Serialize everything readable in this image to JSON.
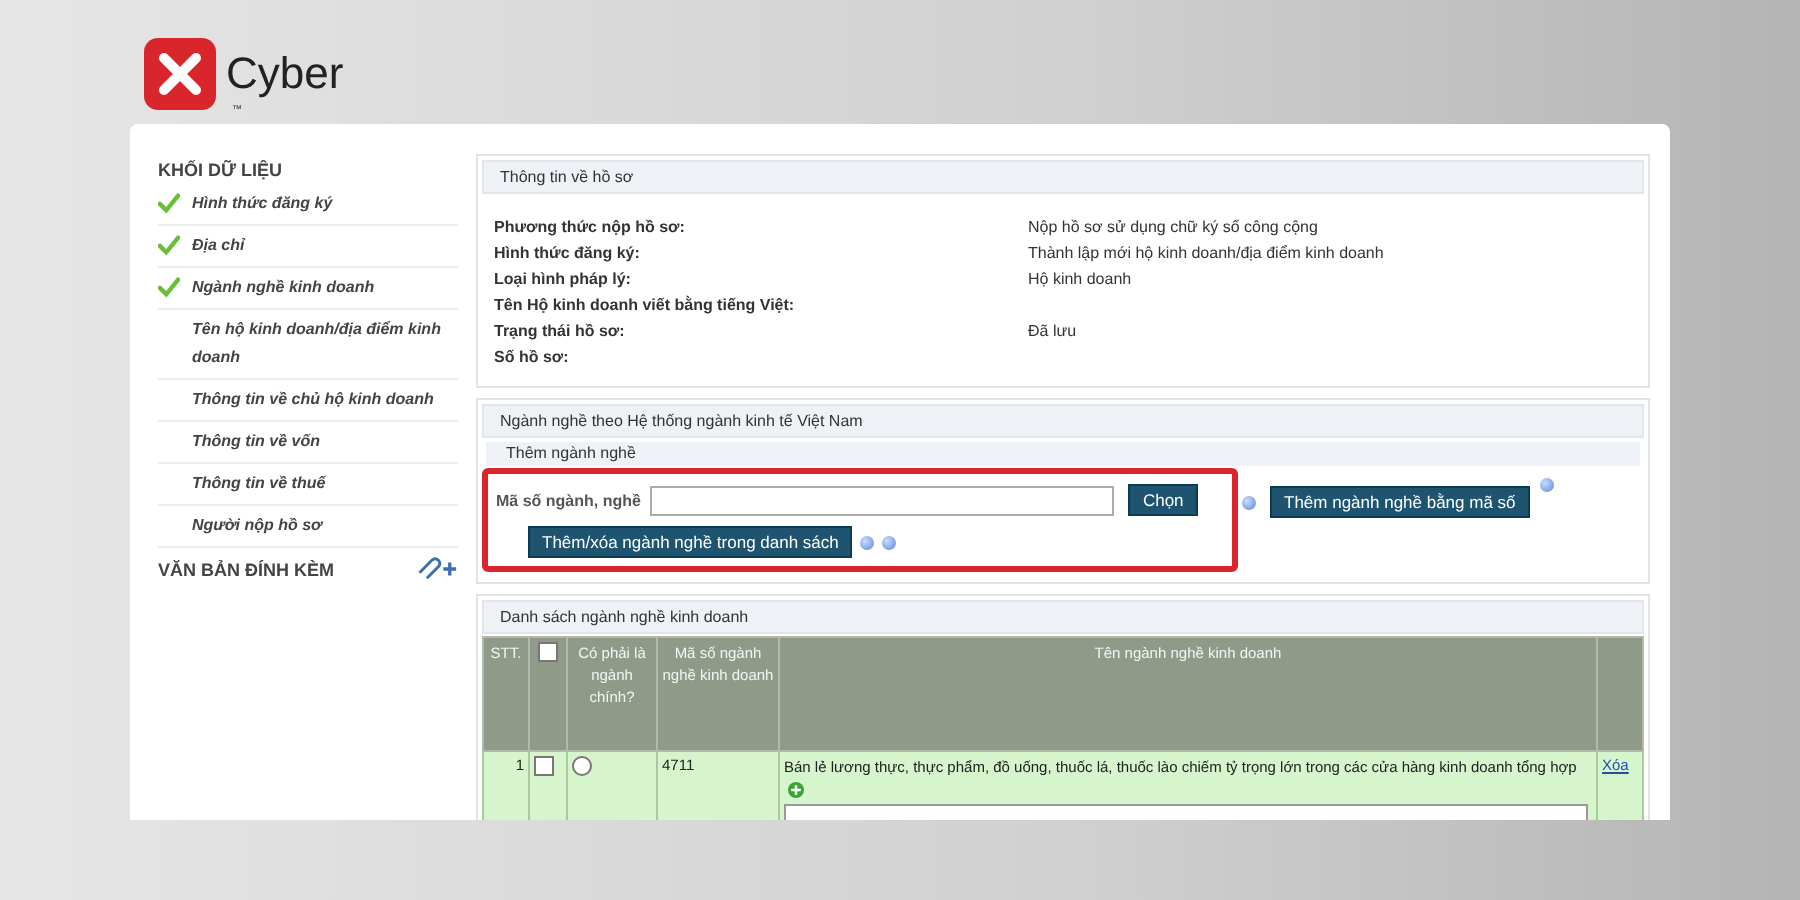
{
  "logo": {
    "name": "Cyber",
    "tm": "™"
  },
  "sidebar": {
    "heading": "KHỐI DỮ LIỆU",
    "items": [
      {
        "label": "Hình thức đăng ký",
        "done": true
      },
      {
        "label": "Địa chỉ",
        "done": true
      },
      {
        "label": "Ngành nghề kinh doanh",
        "done": true
      },
      {
        "label": "Tên hộ kinh doanh/địa điểm kinh doanh",
        "done": false
      },
      {
        "label": "Thông tin về chủ hộ kinh doanh",
        "done": false
      },
      {
        "label": "Thông tin về vốn",
        "done": false
      },
      {
        "label": "Thông tin về thuế",
        "done": false
      },
      {
        "label": "Người nộp hồ sơ",
        "done": false
      }
    ],
    "attachments": "VĂN BẢN ĐÍNH KÈM"
  },
  "record_info": {
    "title": "Thông tin về hồ sơ",
    "fields": [
      {
        "label": "Phương thức nộp hồ sơ:",
        "value": "Nộp hồ sơ sử dụng chữ ký số công cộng"
      },
      {
        "label": "Hình thức đăng ký:",
        "value": "Thành lập mới hộ kinh doanh/địa điểm kinh doanh"
      },
      {
        "label": "Loại hình pháp lý:",
        "value": "Hộ kinh doanh"
      },
      {
        "label": "Tên Hộ kinh doanh viết bằng tiếng Việt:"
      },
      {
        "label": "Trạng thái hồ sơ:",
        "value": "Đã lưu"
      },
      {
        "label": "Số hồ sơ:"
      }
    ]
  },
  "industry": {
    "title": "Ngành nghề theo Hệ thống ngành kinh tế Việt Nam",
    "subtitle": "Thêm ngành nghề",
    "code_label": "Mã số ngành, nghề",
    "choose_button": "Chọn",
    "add_by_code_button": "Thêm ngành nghề bằng mã số",
    "edit_list_button": "Thêm/xóa ngành nghề trong danh sách"
  },
  "list": {
    "title": "Danh sách ngành nghề kinh doanh",
    "select_all": false,
    "columns": [
      "STT.",
      "Có phải là ngành chính?",
      "Mã số ngành nghề kinh doanh",
      "Tên ngành nghề kinh doanh"
    ],
    "rows": [
      {
        "index": "1",
        "checked": false,
        "main": false,
        "code": "4711",
        "name": "Bán lẻ lương thực, thực phẩm, đồ uống, thuốc lá, thuốc lào chiếm tỷ trọng lớn trong các cửa hàng kinh doanh tổng hợp",
        "action": "Xóa"
      }
    ]
  }
}
